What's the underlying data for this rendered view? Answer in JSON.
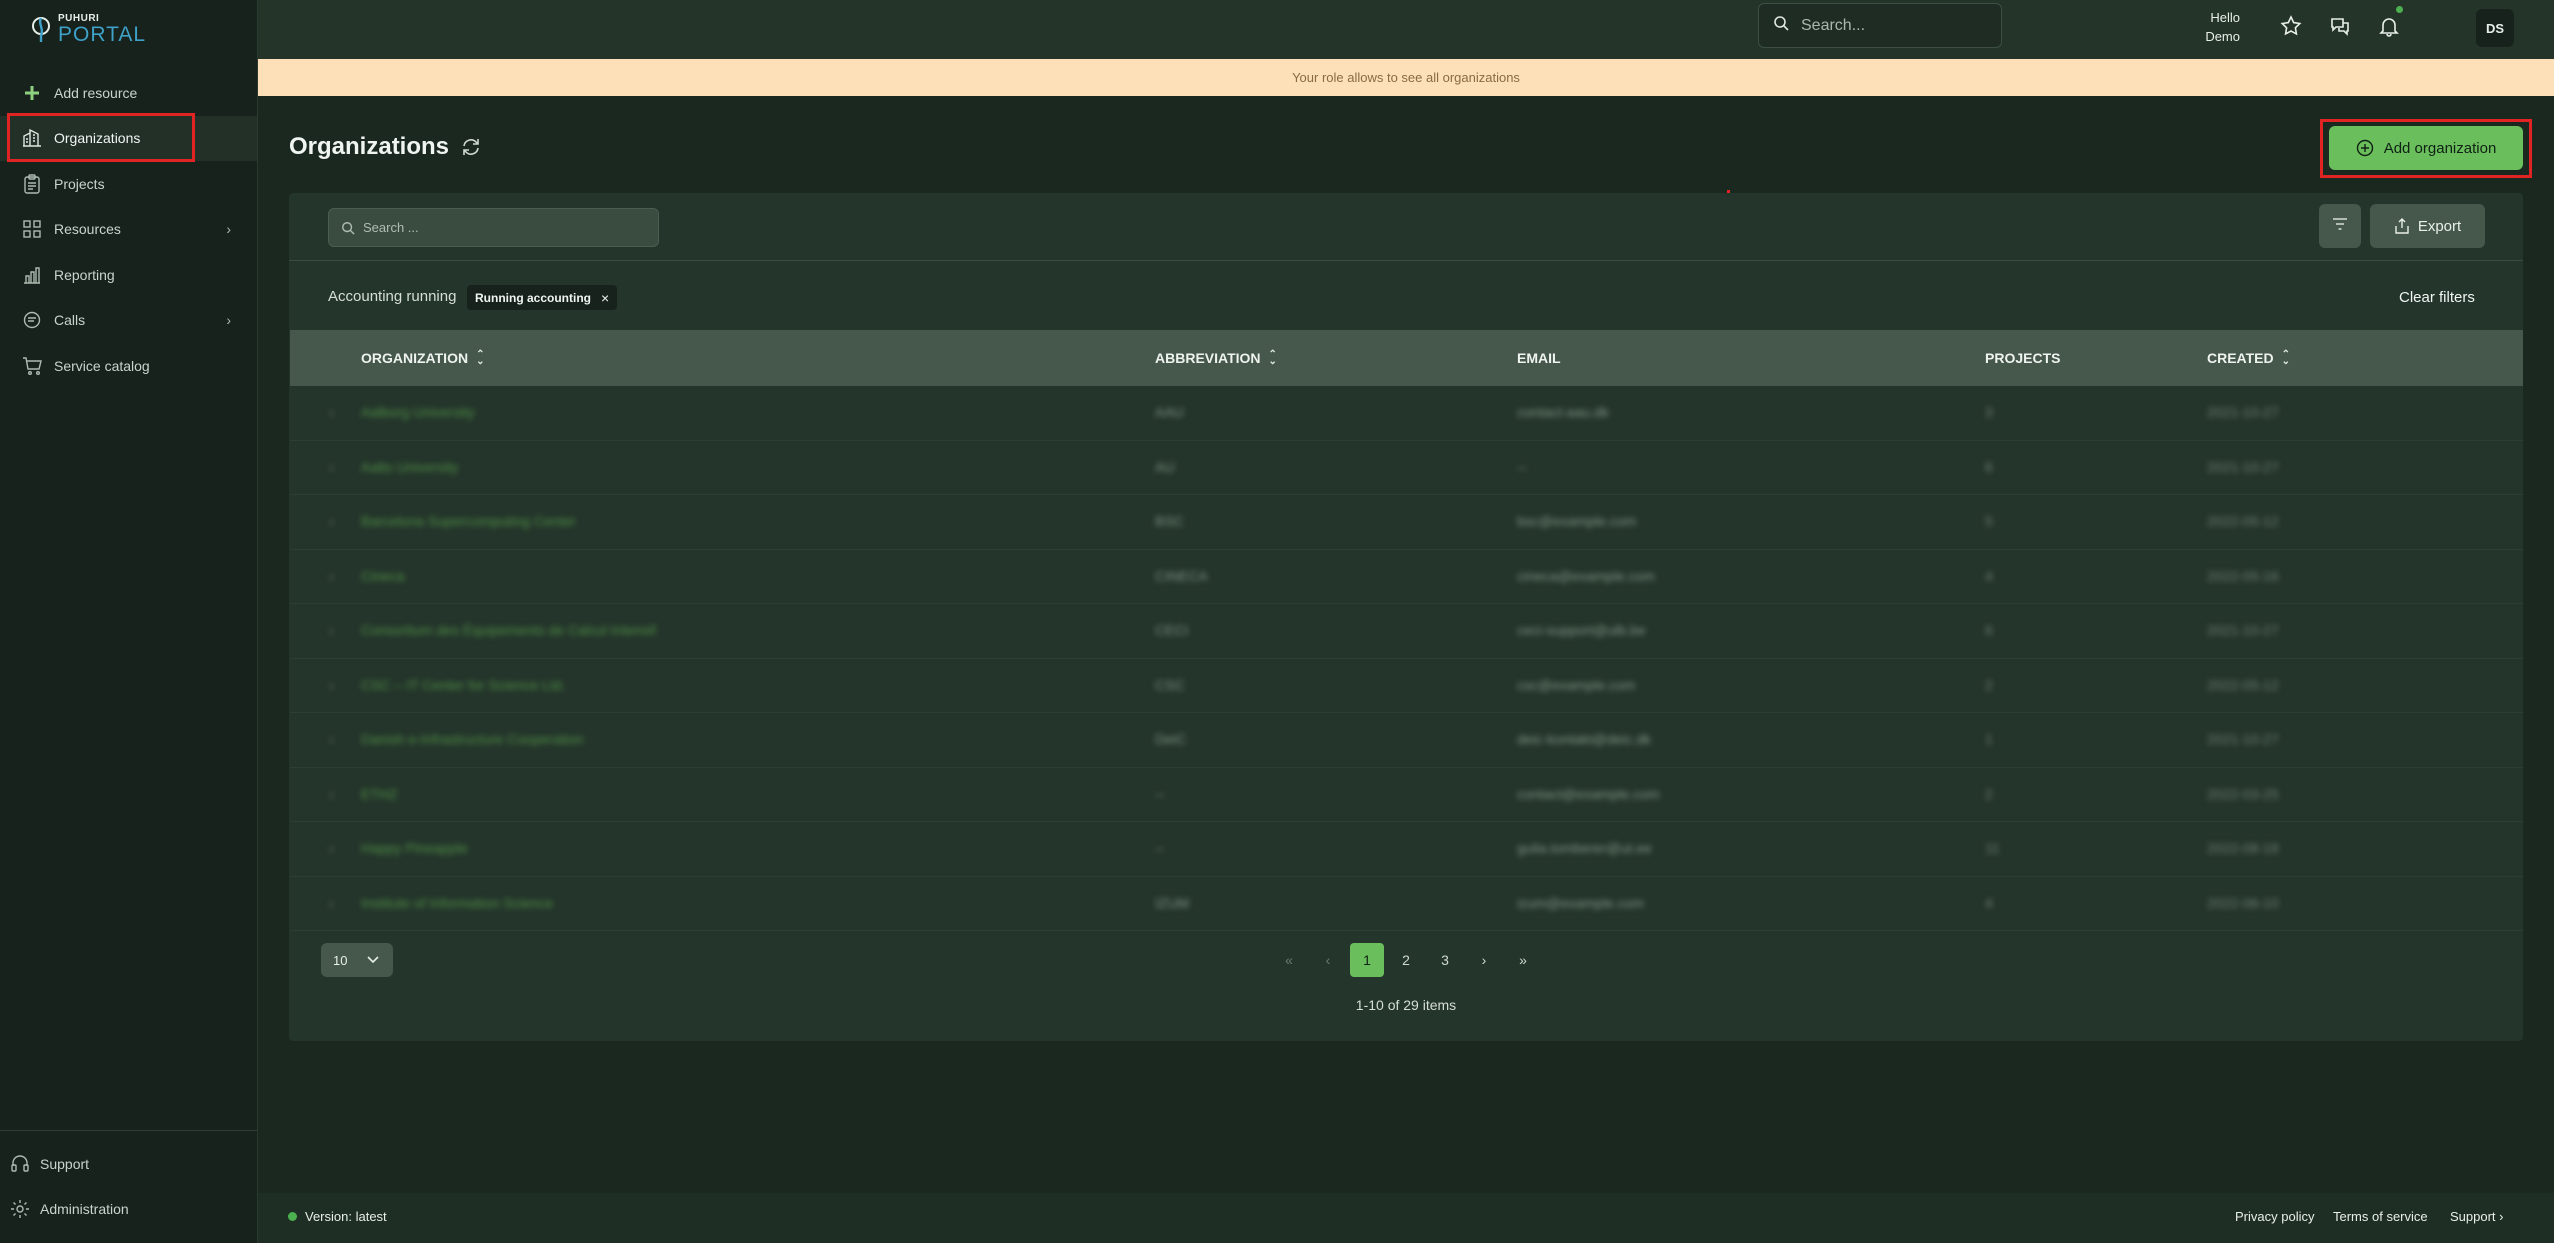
{
  "app": {
    "logo_small": "PUHURI",
    "logo_big": "PORTAL"
  },
  "sidebar": {
    "items": [
      {
        "label": "Add resource",
        "icon": "plus-icon"
      },
      {
        "label": "Organizations",
        "icon": "building-icon",
        "active": true
      },
      {
        "label": "Projects",
        "icon": "clipboard-icon"
      },
      {
        "label": "Resources",
        "icon": "grid-icon",
        "has_children": true
      },
      {
        "label": "Reporting",
        "icon": "bar-chart-icon"
      },
      {
        "label": "Calls",
        "icon": "chat-icon",
        "has_children": true
      },
      {
        "label": "Service catalog",
        "icon": "cart-icon"
      }
    ],
    "bottom": [
      {
        "label": "Support",
        "icon": "headset-icon"
      },
      {
        "label": "Administration",
        "icon": "gear-icon"
      }
    ]
  },
  "topbar": {
    "search_placeholder": "Search...",
    "hello_line1": "Hello",
    "hello_line2": "Demo",
    "avatar_initials": "DS"
  },
  "banner": {
    "text": "Your role allows to see all organizations"
  },
  "page": {
    "title": "Organizations",
    "add_button": "Add organization"
  },
  "table": {
    "search_placeholder": "Search ...",
    "export_label": "Export",
    "filter_label": "Accounting running",
    "filter_chip": "Running accounting",
    "clear_filters": "Clear filters",
    "columns": [
      "ORGANIZATION",
      "ABBREVIATION",
      "EMAIL",
      "PROJECTS",
      "CREATED"
    ],
    "rows": [
      [
        "Aalborg University",
        "AAU",
        "contact-aau.dk",
        "3",
        "2021-10-27"
      ],
      [
        "Aalto University",
        "AU",
        "--",
        "6",
        "2021-10-27"
      ],
      [
        "Barcelona Supercomputing Center",
        "BSC",
        "bsc@example.com",
        "5",
        "2022-05-12"
      ],
      [
        "Cineca",
        "CINECA",
        "cineca@example.com",
        "4",
        "2022-05-16"
      ],
      [
        "Consortium des Équipements de Calcul Intensif",
        "CECI",
        "ceci-support@ulb.be",
        "6",
        "2021-10-27"
      ],
      [
        "CSC – IT Center for Science Ltd.",
        "CSC",
        "csc@example.com",
        "2",
        "2022-05-12"
      ],
      [
        "Danish e-Infrastructure Cooperation",
        "DeiC",
        "deic-kontakt@deic.dk",
        "1",
        "2021-10-27"
      ],
      [
        "ETHZ",
        "--",
        "contact@example.com",
        "2",
        "2022-03-25"
      ],
      [
        "Happy Pineapple",
        "--",
        "gulia.tomberer@ut.ee",
        "11",
        "2022-08-18"
      ],
      [
        "Institute of Information Science",
        "IZUM",
        "izum@example.com",
        "4",
        "2022-06-10"
      ]
    ],
    "page_size": "10",
    "pages": [
      "1",
      "2",
      "3"
    ],
    "current_page": "1",
    "first": "«",
    "prev": "‹",
    "next": "›",
    "last": "»",
    "items_info": "1-10 of 29 items"
  },
  "footer": {
    "version": "Version: latest",
    "privacy": "Privacy policy",
    "terms": "Terms of service",
    "support": "Support ›"
  },
  "colors": {
    "accent": "#6abf5c",
    "highlight": "#e02424",
    "banner_bg": "#fde0b8",
    "sidebar_bg": "#16221b"
  }
}
